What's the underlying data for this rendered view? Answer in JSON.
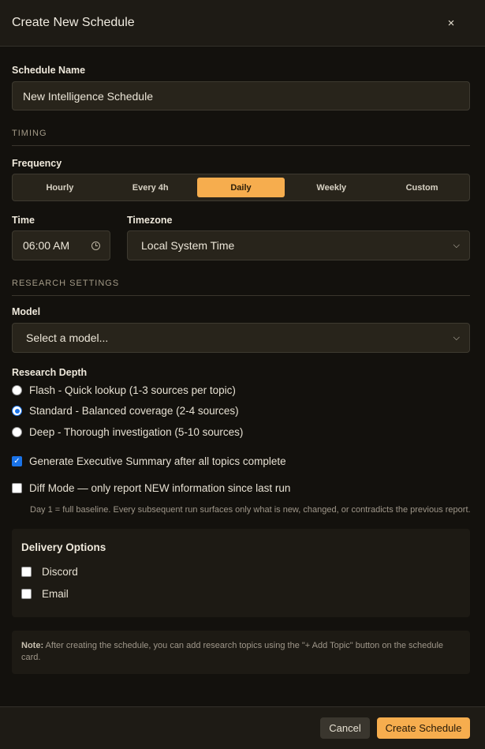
{
  "dialog": {
    "title": "Create New Schedule",
    "close_glyph": "×"
  },
  "schedule_name": {
    "label": "Schedule Name",
    "value": "New Intelligence Schedule"
  },
  "timing": {
    "section_title": "TIMING",
    "frequency_label": "Frequency",
    "frequency_options": [
      "Hourly",
      "Every 4h",
      "Daily",
      "Weekly",
      "Custom"
    ],
    "frequency_selected": "Daily",
    "time_label": "Time",
    "time_value": "06:00 AM",
    "timezone_label": "Timezone",
    "timezone_value": "Local System Time"
  },
  "research": {
    "section_title": "RESEARCH SETTINGS",
    "model_label": "Model",
    "model_value": "Select a model...",
    "depth_label": "Research Depth",
    "depth_options": [
      "Flash - Quick lookup (1-3 sources per topic)",
      "Standard - Balanced coverage (2-4 sources)",
      "Deep - Thorough investigation (5-10 sources)"
    ],
    "depth_selected": 1,
    "exec_summary_label": "Generate Executive Summary after all topics complete",
    "exec_summary_checked": true,
    "diff_mode_label": "Diff Mode — only report NEW information since last run",
    "diff_mode_checked": false,
    "diff_mode_hint": "Day 1 = full baseline. Every subsequent run surfaces only what is new, changed, or contradicts the previous report."
  },
  "delivery": {
    "title": "Delivery Options",
    "discord_label": "Discord",
    "discord_checked": false,
    "email_label": "Email",
    "email_checked": false
  },
  "note": {
    "prefix": "Note:",
    "text": " After creating the schedule, you can add research topics using the \"+ Add Topic\" button on the schedule card."
  },
  "footer": {
    "cancel_label": "Cancel",
    "create_label": "Create Schedule"
  },
  "colors": {
    "accent": "#f6ad4e",
    "background": "#13110d",
    "input_bg": "#28241b",
    "check_blue": "#1a73e8"
  },
  "icons": {
    "close": "close-icon",
    "clock": "clock-icon",
    "chevron": "chevron-down-icon"
  }
}
